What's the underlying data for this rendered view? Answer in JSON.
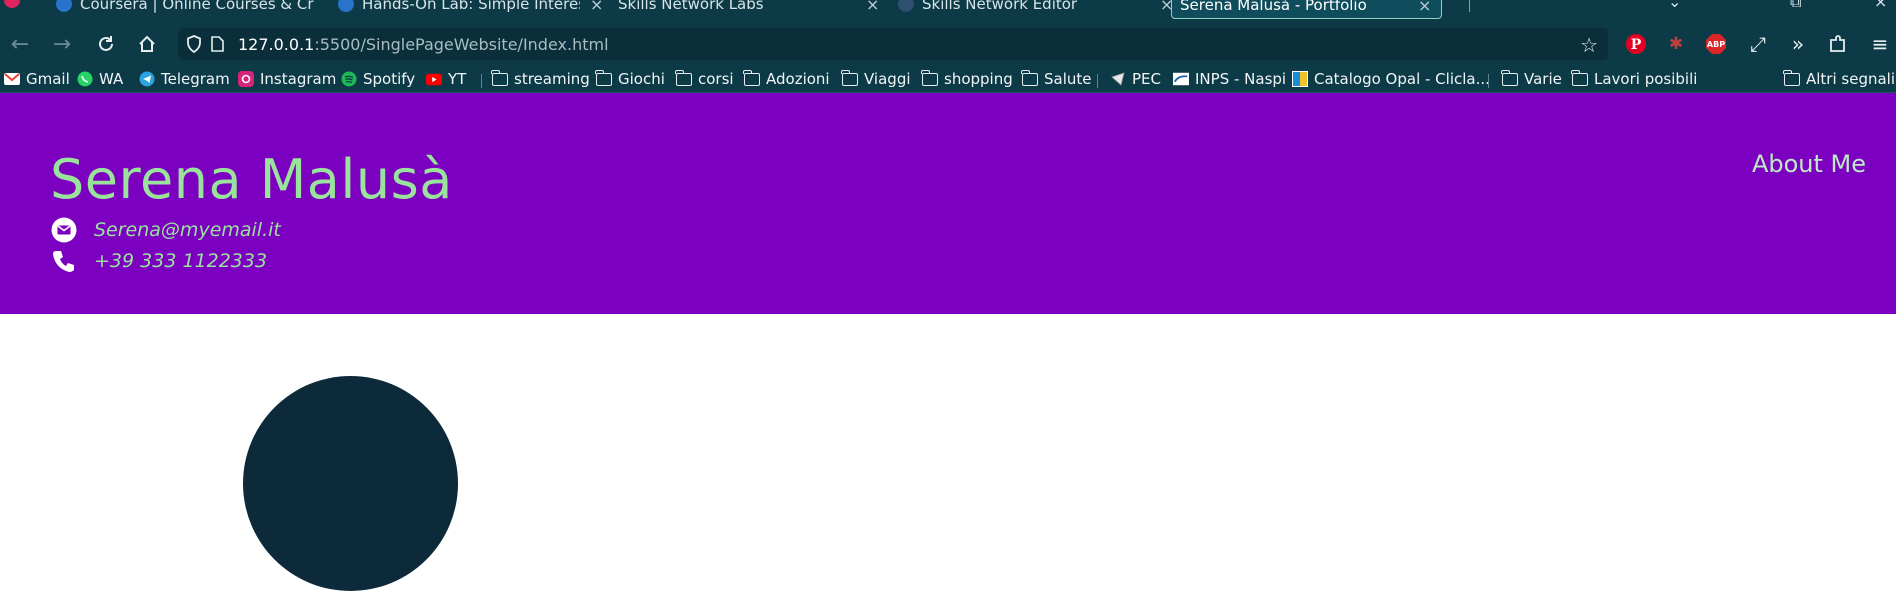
{
  "browser": {
    "tabs": [
      {
        "label": "Coursera | Online Courses & Cr",
        "favicon_color": "#2a73cc"
      },
      {
        "label": "Hands-On Lab: Simple Interest",
        "favicon_color": "#2a73cc"
      },
      {
        "label": "Skills Network Labs",
        "favicon_color": ""
      },
      {
        "label": "Skills Network Editor",
        "favicon_color": "#2f4f6f"
      },
      {
        "label": "Serena Malusà - Portfolio",
        "favicon_color": ""
      }
    ],
    "url": {
      "host": "127.0.0.1",
      "rest": ":5500/SinglePageWebsite/Index.html"
    },
    "extensions": [
      "pinterest-icon",
      "bug-icon",
      "adblock-icon",
      "resize-icon",
      "overflow-icon",
      "puzzle-icon",
      "menu-icon"
    ],
    "adblock_label": "ABP",
    "bookmarks": [
      {
        "label": "Gmail",
        "icon": "gmail-icon"
      },
      {
        "label": "WA",
        "icon": "whatsapp-icon"
      },
      {
        "label": "Telegram",
        "icon": "telegram-icon"
      },
      {
        "label": "Instagram",
        "icon": "instagram-icon"
      },
      {
        "label": "Spotify",
        "icon": "spotify-icon"
      },
      {
        "label": "YT",
        "icon": "youtube-icon"
      },
      {
        "label": "streaming",
        "icon": "folder-icon"
      },
      {
        "label": "Giochi",
        "icon": "folder-icon"
      },
      {
        "label": "corsi",
        "icon": "folder-icon"
      },
      {
        "label": "Adozioni",
        "icon": "folder-icon"
      },
      {
        "label": "Viaggi",
        "icon": "folder-icon"
      },
      {
        "label": "shopping",
        "icon": "folder-icon"
      },
      {
        "label": "Salute",
        "icon": "folder-icon"
      },
      {
        "label": "PEC",
        "icon": "pec-icon"
      },
      {
        "label": "INPS - Naspi",
        "icon": "inps-icon"
      },
      {
        "label": "Catalogo Opal - Clicla...",
        "icon": "opal-icon"
      },
      {
        "label": "Varie",
        "icon": "folder-icon"
      },
      {
        "label": "Lavori posibili",
        "icon": "folder-icon"
      },
      {
        "label": "Altri segnalib",
        "icon": "folder-icon"
      }
    ]
  },
  "site": {
    "title": "Serena Malusà",
    "email": "Serena@myemail.it",
    "phone": "+39 333 1122333",
    "nav": {
      "about": "About Me"
    },
    "colors": {
      "header_bg": "#7b00c0",
      "accent": "#9ae39c",
      "avatar": "#0d2a3a"
    }
  }
}
